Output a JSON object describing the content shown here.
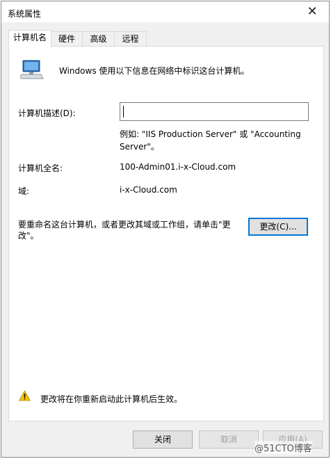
{
  "window": {
    "title": "系统属性",
    "close_glyph": "✕"
  },
  "tabs": [
    {
      "label": "计算机名",
      "active": true
    },
    {
      "label": "硬件",
      "active": false
    },
    {
      "label": "高级",
      "active": false
    },
    {
      "label": "远程",
      "active": false
    }
  ],
  "panel": {
    "icon": "computer-icon",
    "intro": "Windows 使用以下信息在网络中标识这台计算机。",
    "description_label": "计算机描述(D):",
    "description_value": "",
    "example_text": "例如: \"IIS Production Server\" 或 \"Accounting Server\"。",
    "full_name_label": "计算机全名:",
    "full_name_value": "100-Admin01.i-x-Cloud.com",
    "domain_label": "域:",
    "domain_value": "i-x-Cloud.com",
    "rename_text": "要重命名这台计算机，或者更改其域或工作组，请单击\"更改\"。",
    "change_button": "更改(C)...",
    "warning_icon": "warning-icon",
    "warning_text": "更改将在你重新启动此计算机后生效。"
  },
  "footer": {
    "close_button": "关闭",
    "cancel_button": "取消",
    "apply_button": "应用(A)"
  },
  "watermark": "@51CTO博客",
  "colors": {
    "accent": "#0078d7",
    "warning": "#f5c400"
  }
}
